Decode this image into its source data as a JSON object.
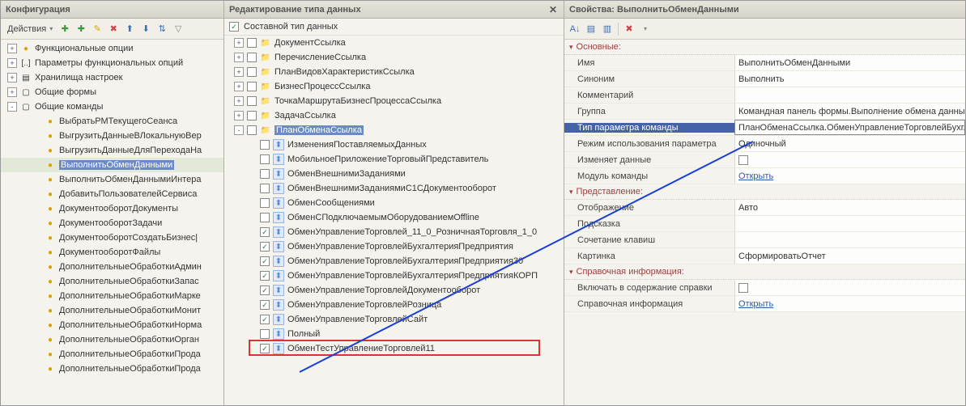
{
  "left": {
    "title": "Конфигурация",
    "actions_label": "Действия",
    "tree": [
      {
        "level": 0,
        "exp": "+",
        "icon": "●",
        "iconCls": "ic-yellow",
        "label": "Функциональные опции"
      },
      {
        "level": 0,
        "exp": "+",
        "icon": "[..]",
        "iconCls": "",
        "label": "Параметры функциональных опций"
      },
      {
        "level": 0,
        "exp": "+",
        "icon": "▤",
        "iconCls": "",
        "label": "Хранилища настроек"
      },
      {
        "level": 0,
        "exp": "+",
        "icon": "▢",
        "iconCls": "",
        "label": "Общие формы"
      },
      {
        "level": 0,
        "exp": "-",
        "icon": "▢",
        "iconCls": "",
        "label": "Общие команды"
      },
      {
        "level": 1,
        "exp": "",
        "icon": "●",
        "iconCls": "ic-yellow",
        "label": "ВыбратьРМТекущегоСеанса"
      },
      {
        "level": 1,
        "exp": "",
        "icon": "●",
        "iconCls": "ic-yellow",
        "label": "ВыгрузитьДанныеВЛокальнуюВер"
      },
      {
        "level": 1,
        "exp": "",
        "icon": "●",
        "iconCls": "ic-yellow",
        "label": "ВыгрузитьДанныеДляПереходаНа"
      },
      {
        "level": 1,
        "exp": "",
        "icon": "●",
        "iconCls": "ic-yellow",
        "label": "ВыполнитьОбменДанными",
        "selected": true
      },
      {
        "level": 1,
        "exp": "",
        "icon": "●",
        "iconCls": "ic-yellow",
        "label": "ВыполнитьОбменДаннымиИнтера"
      },
      {
        "level": 1,
        "exp": "",
        "icon": "●",
        "iconCls": "ic-yellow",
        "label": "ДобавитьПользователейСервиса"
      },
      {
        "level": 1,
        "exp": "",
        "icon": "●",
        "iconCls": "ic-yellow",
        "label": "ДокументооборотДокументы"
      },
      {
        "level": 1,
        "exp": "",
        "icon": "●",
        "iconCls": "ic-yellow",
        "label": "ДокументооборотЗадачи"
      },
      {
        "level": 1,
        "exp": "",
        "icon": "●",
        "iconCls": "ic-yellow",
        "label": "ДокументооборотСоздатьБизнес|"
      },
      {
        "level": 1,
        "exp": "",
        "icon": "●",
        "iconCls": "ic-yellow",
        "label": "ДокументооборотФайлы"
      },
      {
        "level": 1,
        "exp": "",
        "icon": "●",
        "iconCls": "ic-yellow",
        "label": "ДополнительныеОбработкиАдмин"
      },
      {
        "level": 1,
        "exp": "",
        "icon": "●",
        "iconCls": "ic-yellow",
        "label": "ДополнительныеОбработкиЗапас"
      },
      {
        "level": 1,
        "exp": "",
        "icon": "●",
        "iconCls": "ic-yellow",
        "label": "ДополнительныеОбработкиМаркe"
      },
      {
        "level": 1,
        "exp": "",
        "icon": "●",
        "iconCls": "ic-yellow",
        "label": "ДополнительныеОбработкиМонит"
      },
      {
        "level": 1,
        "exp": "",
        "icon": "●",
        "iconCls": "ic-yellow",
        "label": "ДополнительныеОбработкиНорма"
      },
      {
        "level": 1,
        "exp": "",
        "icon": "●",
        "iconCls": "ic-yellow",
        "label": "ДополнительныеОбработкиОрган"
      },
      {
        "level": 1,
        "exp": "",
        "icon": "●",
        "iconCls": "ic-yellow",
        "label": "ДополнительныеОбработкиПрода"
      },
      {
        "level": 1,
        "exp": "",
        "icon": "●",
        "iconCls": "ic-yellow",
        "label": "ДополнительныеОбработкиПрода"
      }
    ]
  },
  "mid": {
    "title": "Редактирование типа данных",
    "composite_label": "Составной тип данных",
    "folders": [
      {
        "exp": "+",
        "label": "ДокументСсылка"
      },
      {
        "exp": "+",
        "label": "ПеречислениеСсылка"
      },
      {
        "exp": "+",
        "label": "ПланВидовХарактеристикСсылка"
      },
      {
        "exp": "+",
        "label": "БизнесПроцессСсылка"
      },
      {
        "exp": "+",
        "label": "ТочкаМаршрутаБизнесПроцессаСсылка"
      },
      {
        "exp": "+",
        "label": "ЗадачаСсылка"
      },
      {
        "exp": "-",
        "label": "ПланОбменаСсылка",
        "selected": true
      }
    ],
    "items": [
      {
        "checked": false,
        "label": "ИзмененияПоставляемыхДанных"
      },
      {
        "checked": false,
        "label": "МобильноеПриложениеТорговыйПредставитель"
      },
      {
        "checked": false,
        "label": "ОбменВнешнимиЗаданиями"
      },
      {
        "checked": false,
        "label": "ОбменВнешнимиЗаданиямиС1СДокументооборот"
      },
      {
        "checked": false,
        "label": "ОбменСообщениями"
      },
      {
        "checked": false,
        "label": "ОбменСПодключаемымОборудованиемOffline"
      },
      {
        "checked": true,
        "label": "ОбменУправлениеТорговлей_11_0_РозничнаяТорговля_1_0"
      },
      {
        "checked": true,
        "label": "ОбменУправлениеТорговлейБухгалтерияПредприятия"
      },
      {
        "checked": true,
        "label": "ОбменУправлениеТорговлейБухгалтерияПредприятия30"
      },
      {
        "checked": true,
        "label": "ОбменУправлениеТорговлейБухгалтерияПредприятияКОРП"
      },
      {
        "checked": true,
        "label": "ОбменУправлениеТорговлейДокументооборот"
      },
      {
        "checked": true,
        "label": "ОбменУправлениеТорговлейРозница"
      },
      {
        "checked": true,
        "label": "ОбменУправлениеТорговлейСайт"
      },
      {
        "checked": false,
        "label": "Полный"
      },
      {
        "checked": true,
        "label": "ОбменТестУправлениеТорговлей11",
        "highlight": true
      }
    ]
  },
  "right": {
    "title": "Свойства: ВыполнитьОбменДанными",
    "sections": {
      "main": "Основные:",
      "presentation": "Представление:",
      "reference": "Справочная информация:"
    },
    "props": {
      "name_label": "Имя",
      "name_value": "ВыполнитьОбменДанными",
      "synonym_label": "Синоним",
      "synonym_value": "Выполнить",
      "comment_label": "Комментарий",
      "comment_value": "",
      "group_label": "Группа",
      "group_value": "Командная панель формы.Выполнение обмена данным",
      "param_type_label": "Тип параметра команды",
      "param_type_value": "ПланОбменаСсылка.ОбменУправлениеТорговлейБухг...",
      "usage_label": "Режим использования параметра",
      "usage_value": "Одиночный",
      "changes_label": "Изменяет данные",
      "module_label": "Модуль команды",
      "module_link": "Открыть",
      "display_label": "Отображение",
      "display_value": "Авто",
      "hint_label": "Подсказка",
      "hint_value": "",
      "shortcut_label": "Сочетание клавиш",
      "shortcut_value": "",
      "picture_label": "Картинка",
      "picture_value": "СформироватьОтчет",
      "include_help_label": "Включать в содержание справки",
      "help_info_label": "Справочная информация",
      "help_info_link": "Открыть"
    }
  }
}
